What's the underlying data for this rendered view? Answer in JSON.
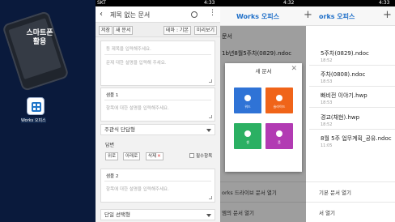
{
  "desktop": {
    "widget_title": "스마트폰\n활용",
    "app_label": "Works 오피스"
  },
  "editor": {
    "status": {
      "left": "SKT",
      "right": "4:33"
    },
    "doc_title": "제목 없는 문서",
    "toolbar": {
      "save": "저장",
      "new_doc": "새 문서",
      "theme": "테마 : 기본",
      "preview": "미리보기"
    },
    "title_placeholder": "등 제목을 입력해주세요.",
    "desc_placeholder": "문제 대한 설명을 입력해 주세요.",
    "section1": {
      "label": "샘플 1",
      "placeholder": "항목에 대한 설명을 입력해주세요."
    },
    "question_type1": "주관식 단답형",
    "answer_label": "답변",
    "chips": [
      "위로",
      "아래로",
      "삭제"
    ],
    "required_label": "필수항목",
    "section2": {
      "label": "샘플 2",
      "placeholder": "항목에 대한 설명을 입력해주세요."
    },
    "question_type2": "단일 선택형"
  },
  "files": {
    "status_left": "4:32",
    "status_right": "4:33",
    "title_left": "Works 오피스",
    "title_right": "orks 오피스",
    "list_header": "문서",
    "items_left": [
      {
        "name": "1b년8월5주차(0829).ndoc"
      }
    ],
    "items_right": [
      {
        "name": "5주차(0829).ndoc",
        "time": "18:52"
      },
      {
        "name": "주차(0808).ndoc",
        "time": "18:53"
      },
      {
        "name": "빠비전 이야기.hwp",
        "time": "18:53"
      },
      {
        "name": "경교(채현).hwp",
        "time": "18:52"
      },
      {
        "name": "8월 5주 업무계획_공유.ndoc",
        "time": "11:05"
      }
    ],
    "dialog": {
      "title": "새 문서",
      "tiles": [
        {
          "label": "워드",
          "color": "#2f73d6"
        },
        {
          "label": "슬라이드",
          "color": "#f06419"
        },
        {
          "label": "셀",
          "color": "#2bb063"
        },
        {
          "label": "폼",
          "color": "#b23bb3"
        }
      ]
    },
    "bottom_left": [
      "orks 드라이브 문서 열기",
      "엠의 문서 열기"
    ],
    "bottom_right": [
      "기본 문서 열기",
      "서 열기"
    ]
  }
}
